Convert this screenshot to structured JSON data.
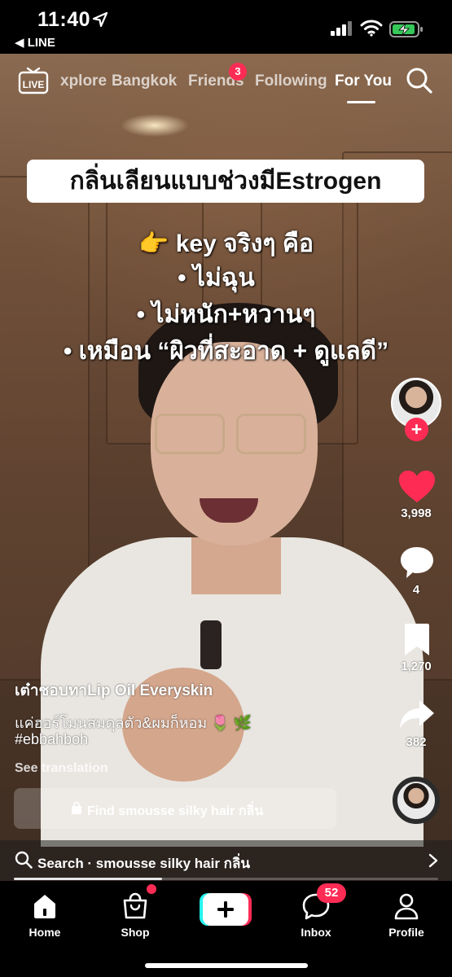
{
  "status_bar": {
    "time": "11:40",
    "back_app": "◀ LINE",
    "icons": [
      "location-arrow-icon",
      "cellular-signal-icon",
      "wifi-icon",
      "battery-charging-icon"
    ]
  },
  "top_nav": {
    "live_label": "LIVE",
    "tabs": [
      {
        "label": "Explore",
        "shown": "xplore"
      },
      {
        "label": "Bangkok"
      },
      {
        "label": "Friends",
        "badge": "3"
      },
      {
        "label": "Following"
      },
      {
        "label": "For You",
        "active": true
      }
    ]
  },
  "overlay": {
    "title": "กลิ่นเลียนแบบช่วงมีEstrogen",
    "line1": "👉 key จริงๆ คือ",
    "line2": "•  ไม่ฉุน",
    "line3": "•  ไม่หนัก+หวานๆ",
    "line4": "•  เหมือน “ผิวที่สะอาด + ดูแลดี”"
  },
  "actions": {
    "likes": "3,998",
    "comments": "4",
    "bookmarks": "1,270",
    "shares": "382"
  },
  "caption": {
    "title": "เต๋าชอบทาLip Oil Everyskin",
    "body": "แค่ฮอร์โมนสมดุลตัว&ผมก็หอม 🌷 🌿",
    "hashtag": "#ebbahboh",
    "see_translation": "See translation",
    "find_label": "Find smousse silky hair กลิ่น"
  },
  "search_suggestion": {
    "text": "Search · smousse silky hair กลิ่น"
  },
  "playback": {
    "progress": 0.35
  },
  "tab_bar": {
    "home": "Home",
    "shop": "Shop",
    "inbox": "Inbox",
    "inbox_badge": "52",
    "profile": "Profile"
  },
  "colors": {
    "accent": "#fe2c55",
    "tiktok_cyan": "#25f4ee",
    "background": "#000000"
  }
}
